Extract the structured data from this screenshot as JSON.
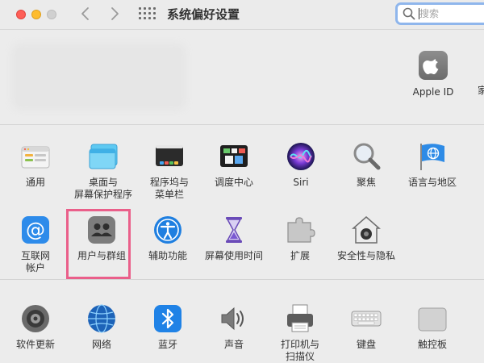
{
  "window": {
    "title": "系统偏好设置",
    "search_placeholder": "搜索"
  },
  "account": {
    "apple_id_label": "Apple ID",
    "family_label": "家"
  },
  "row1": [
    {
      "label": [
        "通用"
      ],
      "icon": "general-icon"
    },
    {
      "label": [
        "桌面与",
        "屏幕保护程序"
      ],
      "icon": "desktop-screensaver-icon"
    },
    {
      "label": [
        "程序坞与",
        "菜单栏"
      ],
      "icon": "dock-menubar-icon"
    },
    {
      "label": [
        "调度中心"
      ],
      "icon": "mission-control-icon"
    },
    {
      "label": [
        "Siri"
      ],
      "icon": "siri-icon"
    },
    {
      "label": [
        "聚焦"
      ],
      "icon": "spotlight-icon"
    },
    {
      "label": [
        "语言与地区"
      ],
      "icon": "language-region-icon"
    }
  ],
  "row2": [
    {
      "label": [
        "互联网",
        "帐户"
      ],
      "icon": "internet-accounts-icon"
    },
    {
      "label": [
        "用户与群组"
      ],
      "icon": "users-groups-icon"
    },
    {
      "label": [
        "辅助功能"
      ],
      "icon": "accessibility-icon"
    },
    {
      "label": [
        "屏幕使用时间"
      ],
      "icon": "screen-time-icon"
    },
    {
      "label": [
        "扩展"
      ],
      "icon": "extensions-icon"
    },
    {
      "label": [
        "安全性与隐私"
      ],
      "icon": "security-privacy-icon"
    }
  ],
  "row3": [
    {
      "label": [
        "软件更新"
      ],
      "icon": "software-update-icon"
    },
    {
      "label": [
        "网络"
      ],
      "icon": "network-icon"
    },
    {
      "label": [
        "蓝牙"
      ],
      "icon": "bluetooth-icon"
    },
    {
      "label": [
        "声音"
      ],
      "icon": "sound-icon"
    },
    {
      "label": [
        "打印机与",
        "扫描仪"
      ],
      "icon": "printers-scanners-icon"
    },
    {
      "label": [
        "键盘"
      ],
      "icon": "keyboard-icon"
    },
    {
      "label": [
        "触控板"
      ],
      "icon": "trackpad-icon"
    }
  ],
  "highlight_color": "#ea5f8a"
}
